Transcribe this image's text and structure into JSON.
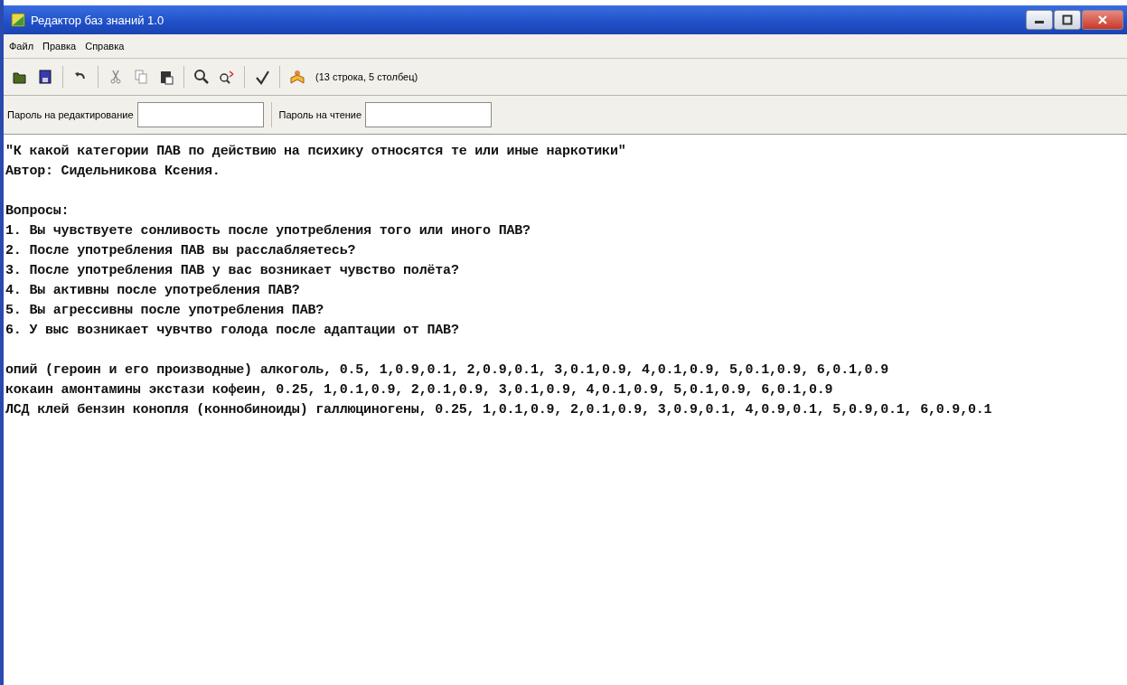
{
  "window": {
    "title": "Редактор баз знаний 1.0"
  },
  "menu": [
    "Файл",
    "Правка",
    "Справка"
  ],
  "toolbar": {
    "status": "(13 строка, 5 столбец)"
  },
  "password_fields": [
    {
      "label": "Пароль на редактирование"
    },
    {
      "label": "Пароль на чтение"
    }
  ],
  "editor": {
    "header": [
      "\"К какой категории ПАВ по действию на психику относятся те или иные наркотики\"",
      "Автор: Сидельникова Ксения."
    ],
    "questions_heading": "Вопросы:",
    "questions": [
      "1. Вы чувствуете сонливость после употребления того или иного ПАВ?",
      "2. После употребления ПАВ вы расслабляетесь?",
      "3. После употребления ПАВ у вас возникает чувство полёта?",
      "4. Вы активны после употребления ПАВ?",
      "5. Вы агрессивны после употребления ПАВ?",
      "6. У выс возникает чувчтво голода после адаптации от ПАВ?"
    ],
    "rules": [
      "опий (героин и его производные) алкоголь, 0.5, 1,0.9,0.1, 2,0.9,0.1, 3,0.1,0.9, 4,0.1,0.9, 5,0.1,0.9, 6,0.1,0.9",
      "кокаин амонтамины экстази кофеин, 0.25, 1,0.1,0.9, 2,0.1,0.9, 3,0.1,0.9, 4,0.1,0.9, 5,0.1,0.9, 6,0.1,0.9",
      "ЛСД клей бензин конопля (коннобиноиды) галлюциногены, 0.25, 1,0.1,0.9, 2,0.1,0.9, 3,0.9,0.1, 4,0.9,0.1, 5,0.9,0.1, 6,0.9,0.1"
    ]
  }
}
